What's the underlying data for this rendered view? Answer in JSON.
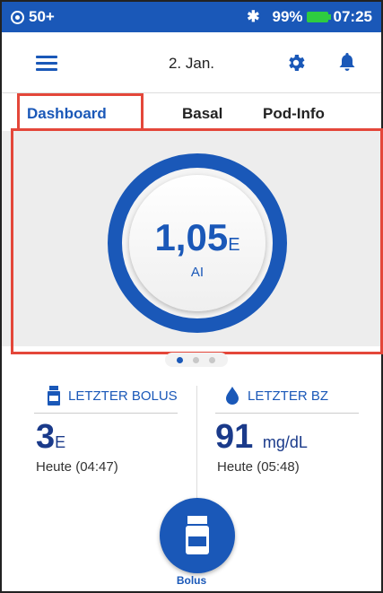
{
  "status_bar": {
    "pod_count": "50+",
    "battery": "99%",
    "time": "07:25"
  },
  "header": {
    "date": "2. Jan."
  },
  "tabs": [
    {
      "label": "Dashboard"
    },
    {
      "label": "Basal"
    },
    {
      "label": "Pod-Info"
    }
  ],
  "dashboard": {
    "insulin_value": "1,05",
    "insulin_unit": "E",
    "insulin_label": "AI"
  },
  "last_bolus": {
    "title": "LETZTER BOLUS",
    "value": "3",
    "unit": "E",
    "time": "Heute (04:47)"
  },
  "last_bg": {
    "title": "LETZTER BZ",
    "value": "91",
    "unit": "mg/dL",
    "time": "Heute (05:48)"
  },
  "bolus_button": {
    "label": "Bolus"
  },
  "colors": {
    "primary": "#1a58b8",
    "highlight": "#e4473a",
    "battery": "#2ecc40"
  }
}
